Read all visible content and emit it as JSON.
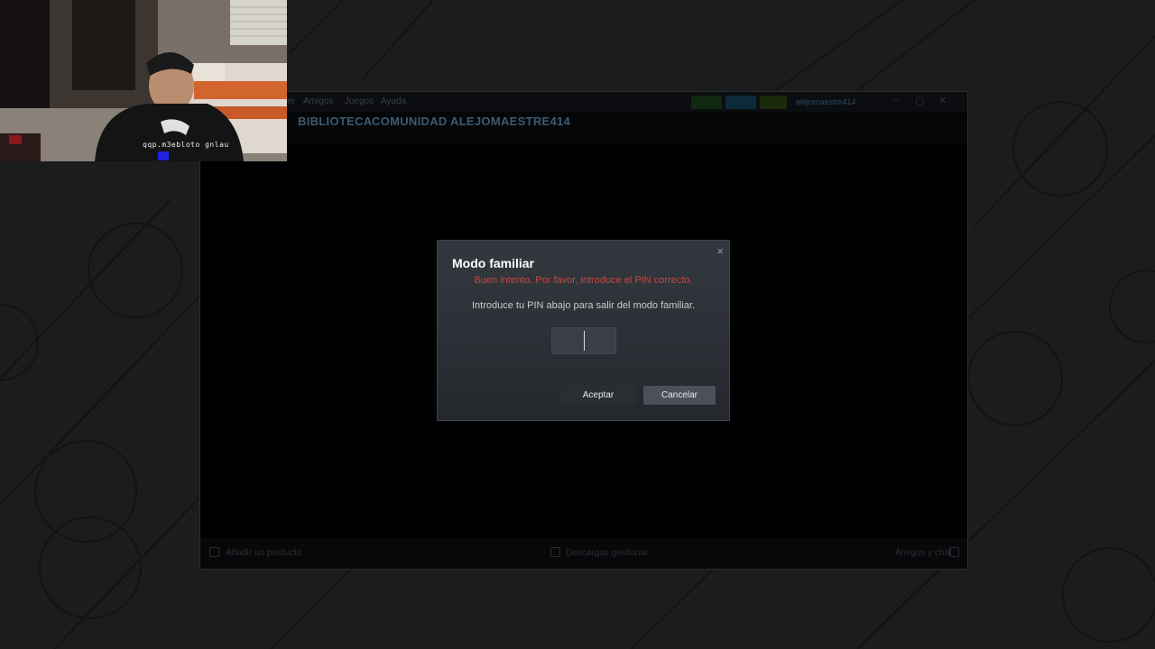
{
  "steam": {
    "menu": [
      "Ver",
      "Amigos",
      "Juegos",
      "Ayuda"
    ],
    "nav": [
      "BIBLIOTECA",
      "COMUNIDAD",
      "ALEJOMAESTRE414"
    ],
    "username": "alejomaestre414",
    "bottom": {
      "left": "Añadir un producto",
      "center": "Descargas gestionar",
      "right": "Amigos y chat"
    },
    "colors": {
      "accent": "#3c5b73",
      "background": "#000000"
    }
  },
  "dialog": {
    "title": "Modo familiar",
    "error": "Buen intento. Por favor, introduce el PIN correcto.",
    "instructions": "Introduce tu PIN abajo para salir del modo familiar.",
    "pin_value": "",
    "accept_label": "Aceptar",
    "cancel_label": "Cancelar",
    "close_icon": "×",
    "colors": {
      "error": "#c8473f",
      "title": "#ffffff"
    }
  },
  "webcam": {
    "caption": "qqp.m3ebloto gnlau"
  }
}
